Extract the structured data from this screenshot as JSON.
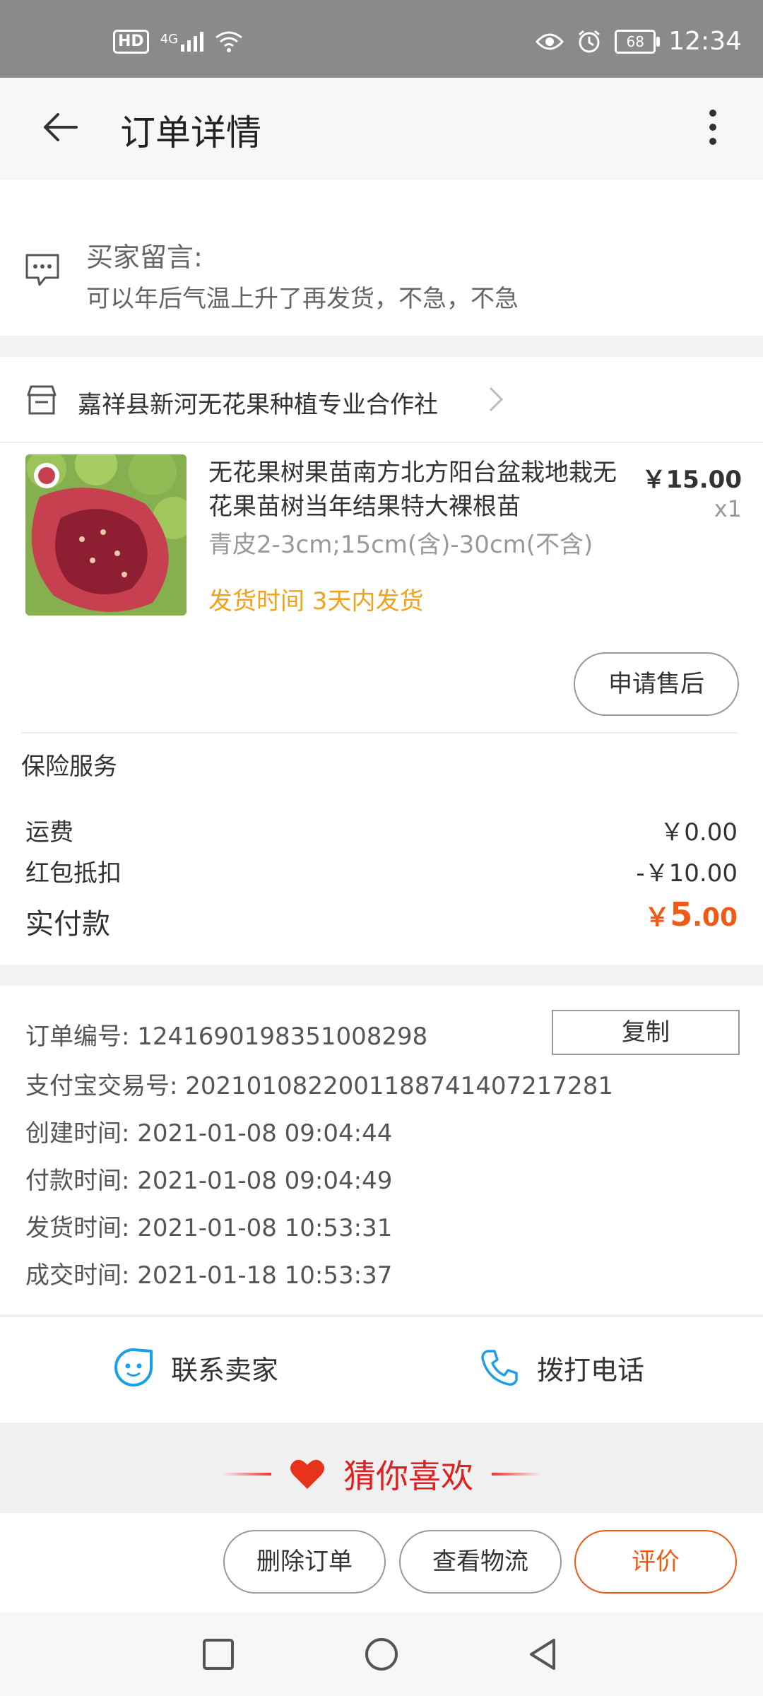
{
  "status_bar": {
    "hd": "HD",
    "network": "4G",
    "battery": "68",
    "time": "12:34"
  },
  "header": {
    "title": "订单详情"
  },
  "buyer_message": {
    "label": "买家留言:",
    "text": "可以年后气温上升了再发货，不急，不急"
  },
  "store": {
    "name": "嘉祥县新河无花果种植专业合作社"
  },
  "product": {
    "title": "无花果树果苗南方北方阳台盆栽地栽无花果苗树当年结果特大裸根苗",
    "sku": "青皮2-3cm;15cm(含)-30cm(不含)",
    "shipping": "发货时间 3天内发货",
    "price": "￥15.00",
    "quantity": "x1",
    "after_sale_label": "申请售后"
  },
  "insurance": {
    "label": "保险服务"
  },
  "summary": {
    "freight_label": "运费",
    "freight_value": "￥0.00",
    "red_packet_label": "红包抵扣",
    "red_packet_value": "-￥10.00",
    "paid_label": "实付款",
    "paid_currency": "￥",
    "paid_int": "5",
    "paid_dec": ".00"
  },
  "order_info": {
    "copy_label": "复制",
    "order_no": "订单编号: 1241690198351008298",
    "alipay_no": "支付宝交易号: 2021010822001188741407217281",
    "created": "创建时间: 2021-01-08 09:04:44",
    "paid": "付款时间: 2021-01-08 09:04:49",
    "shipped": "发货时间: 2021-01-08 10:53:31",
    "completed": "成交时间: 2021-01-18 10:53:37"
  },
  "contact": {
    "seller_label": "联系卖家",
    "phone_label": "拨打电话"
  },
  "recommend": {
    "title": "猜你喜欢"
  },
  "actions": {
    "delete_label": "删除订单",
    "logistics_label": "查看物流",
    "rate_label": "评价"
  },
  "colors": {
    "accent": "#f05a14",
    "shipping_text": "#f0a21b",
    "recommend_red": "#e02020",
    "contact_blue": "#1aa0e8"
  }
}
